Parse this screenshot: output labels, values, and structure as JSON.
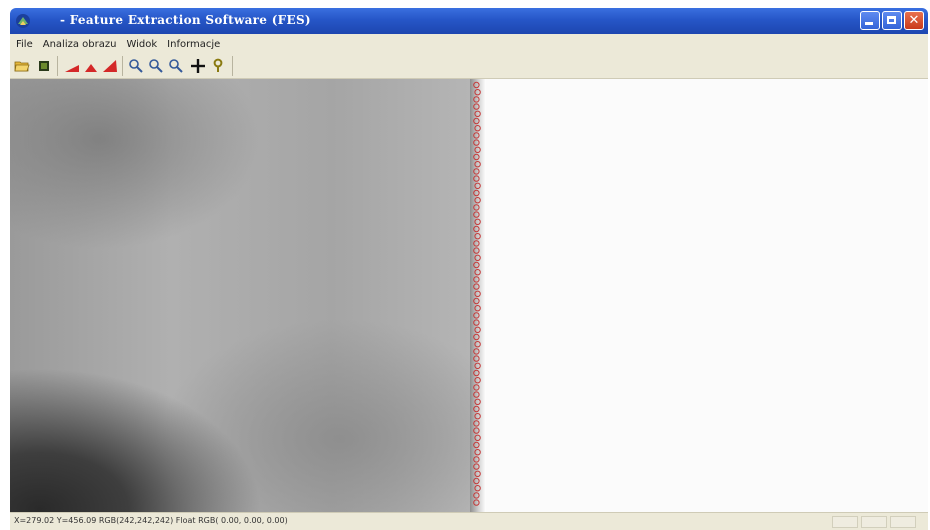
{
  "window": {
    "title": "- Feature Extraction Software (FES)"
  },
  "menu": {
    "items": [
      "File",
      "Analiza obrazu",
      "Widok",
      "Informacje"
    ]
  },
  "toolbar": {
    "buttons": [
      {
        "icon": "open-folder-icon"
      },
      {
        "icon": "grid-icon"
      },
      {
        "icon": "red-wedge-icon"
      },
      {
        "icon": "red-triangle-icon"
      },
      {
        "icon": "red-wedge-large-icon"
      },
      {
        "icon": "zoom-in-icon"
      },
      {
        "icon": "zoom-out-icon"
      },
      {
        "icon": "zoom-reset-icon"
      },
      {
        "icon": "crosshair-icon"
      },
      {
        "icon": "help-icon"
      }
    ]
  },
  "status": {
    "text": "X=279.02 Y=456.09 RGB(242,242,242) Float RGB( 0.00, 0.00, 0.00)"
  },
  "colors": {
    "titlebar": "#2656c7",
    "chrome": "#ece9d8",
    "marker": "#c43a3a"
  }
}
